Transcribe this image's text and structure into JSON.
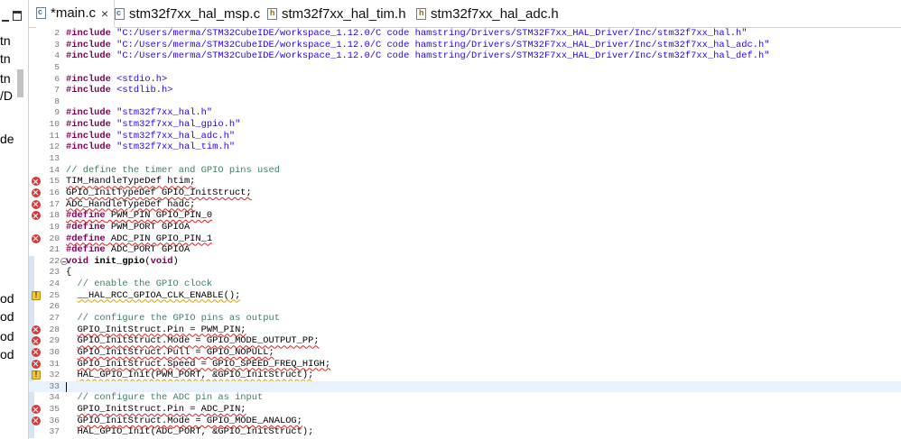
{
  "left_panel": {
    "fragments": [
      "tn",
      "tn",
      "tn",
      "/D",
      "de",
      "od",
      "od",
      "od",
      "od"
    ]
  },
  "tabs": [
    {
      "label": "*main.c",
      "kind": "c",
      "active": true,
      "closable": true
    },
    {
      "label": "stm32f7xx_hal_msp.c",
      "kind": "c",
      "active": false,
      "closable": false
    },
    {
      "label": "stm32f7xx_hal_tim.h",
      "kind": "h",
      "active": false,
      "closable": false
    },
    {
      "label": "stm32f7xx_hal_adc.h",
      "kind": "h",
      "active": false,
      "closable": false
    }
  ],
  "editor": {
    "lines": [
      {
        "n": "2",
        "tokens": [
          [
            "kw",
            "#include"
          ],
          [
            "",
            " "
          ],
          [
            "str",
            "\"C:/Users/merma/STM32CubeIDE/workspace_1.12.0/C code hamstring/Drivers/STM32F7xx_HAL_Driver/Inc/stm32f7xx_hal.h\""
          ]
        ]
      },
      {
        "n": "3",
        "tokens": [
          [
            "kw",
            "#include"
          ],
          [
            "",
            " "
          ],
          [
            "str",
            "\"C:/Users/merma/STM32CubeIDE/workspace_1.12.0/C code hamstring/Drivers/STM32F7xx_HAL_Driver/Inc/stm32f7xx_hal_adc.h\""
          ]
        ]
      },
      {
        "n": "4",
        "tokens": [
          [
            "kw",
            "#include"
          ],
          [
            "",
            " "
          ],
          [
            "str",
            "\"C:/Users/merma/STM32CubeIDE/workspace_1.12.0/C code hamstring/Drivers/STM32F7xx_HAL_Driver/Inc/stm32f7xx_hal_def.h\""
          ]
        ]
      },
      {
        "n": "5",
        "tokens": []
      },
      {
        "n": "6",
        "tokens": [
          [
            "kw",
            "#include"
          ],
          [
            "",
            " "
          ],
          [
            "str",
            "<stdio.h>"
          ]
        ]
      },
      {
        "n": "7",
        "tokens": [
          [
            "kw",
            "#include"
          ],
          [
            "",
            " "
          ],
          [
            "str",
            "<stdlib.h>"
          ]
        ]
      },
      {
        "n": "8",
        "tokens": []
      },
      {
        "n": "9",
        "tokens": [
          [
            "kw",
            "#include"
          ],
          [
            "",
            " "
          ],
          [
            "str",
            "\"stm32f7xx_hal.h\""
          ]
        ]
      },
      {
        "n": "10",
        "tokens": [
          [
            "kw",
            "#include"
          ],
          [
            "",
            " "
          ],
          [
            "str",
            "\"stm32f7xx_hal_gpio.h\""
          ]
        ]
      },
      {
        "n": "11",
        "tokens": [
          [
            "kw",
            "#include"
          ],
          [
            "",
            " "
          ],
          [
            "str",
            "\"stm32f7xx_hal_adc.h\""
          ]
        ]
      },
      {
        "n": "12",
        "tokens": [
          [
            "kw",
            "#include"
          ],
          [
            "",
            " "
          ],
          [
            "str",
            "\"stm32f7xx_hal_tim.h\""
          ]
        ]
      },
      {
        "n": "13",
        "tokens": []
      },
      {
        "n": "14",
        "tokens": [
          [
            "cmt",
            "// define the timer and GPIO pins used"
          ]
        ]
      },
      {
        "n": "15",
        "marker": "error",
        "tokens": [
          [
            "err",
            "TIM_HandleTypeDef htim;"
          ]
        ]
      },
      {
        "n": "16",
        "marker": "error",
        "tokens": [
          [
            "err",
            "GPIO_InitTypeDef GPIO_InitStruct;"
          ]
        ]
      },
      {
        "n": "17",
        "marker": "error",
        "tokens": [
          [
            "err",
            "ADC_HandleTypeDef hadc;"
          ]
        ]
      },
      {
        "n": "18",
        "marker": "error",
        "tokens": [
          [
            "kw err",
            "#define"
          ],
          [
            "err",
            " PWM_PIN GPIO_PIN_0"
          ]
        ]
      },
      {
        "n": "19",
        "tokens": [
          [
            "kw",
            "#define"
          ],
          [
            "",
            " PWM_PORT GPIOA"
          ]
        ]
      },
      {
        "n": "20",
        "marker": "error",
        "tokens": [
          [
            "kw err",
            "#define"
          ],
          [
            "err",
            " ADC_PIN GPIO_PIN_1"
          ]
        ]
      },
      {
        "n": "21",
        "tokens": [
          [
            "kw",
            "#define"
          ],
          [
            "",
            " ADC_PORT GPIOA"
          ]
        ]
      },
      {
        "n": "22",
        "fold": true,
        "tokens": [
          [
            "kw",
            "void"
          ],
          [
            "",
            " "
          ],
          [
            "b",
            "init_gpio"
          ],
          [
            "",
            "("
          ],
          [
            "kw",
            "void"
          ],
          [
            "",
            ")"
          ]
        ]
      },
      {
        "n": "23",
        "tokens": [
          [
            "",
            "{"
          ]
        ]
      },
      {
        "n": "24",
        "tokens": [
          [
            "",
            "  "
          ],
          [
            "cmt",
            "// enable the GPIO clock"
          ]
        ]
      },
      {
        "n": "25",
        "marker": "warning",
        "tokens": [
          [
            "",
            "  "
          ],
          [
            "warn",
            "__HAL_RCC_GPIOA_CLK_ENABLE();"
          ]
        ]
      },
      {
        "n": "26",
        "tokens": []
      },
      {
        "n": "27",
        "tokens": [
          [
            "",
            "  "
          ],
          [
            "cmt",
            "// configure the GPIO pins as output"
          ]
        ]
      },
      {
        "n": "28",
        "marker": "error",
        "tokens": [
          [
            "",
            "  "
          ],
          [
            "err",
            "GPIO_InitStruct.Pin = PWM_PIN;"
          ]
        ]
      },
      {
        "n": "29",
        "marker": "error",
        "tokens": [
          [
            "",
            "  "
          ],
          [
            "err",
            "GPIO_InitStruct.Mode = GPIO_MODE_OUTPUT_PP;"
          ]
        ]
      },
      {
        "n": "30",
        "marker": "error",
        "tokens": [
          [
            "",
            "  "
          ],
          [
            "err",
            "GPIO_InitStruct.Pull = GPIO_NOPULL;"
          ]
        ]
      },
      {
        "n": "31",
        "marker": "error",
        "tokens": [
          [
            "",
            "  "
          ],
          [
            "err",
            "GPIO_InitStruct.Speed = GPIO_SPEED_FREQ_HIGH;"
          ]
        ]
      },
      {
        "n": "32",
        "marker": "warning",
        "tokens": [
          [
            "",
            "  "
          ],
          [
            "warn",
            "HAL_GPIO_Init(PWM_PORT, &GPIO_InitStruct);"
          ]
        ]
      },
      {
        "n": "33",
        "current": true,
        "tokens": []
      },
      {
        "n": "34",
        "tokens": [
          [
            "",
            "  "
          ],
          [
            "cmt",
            "// configure the ADC pin as input"
          ]
        ]
      },
      {
        "n": "35",
        "marker": "error",
        "tokens": [
          [
            "",
            "  "
          ],
          [
            "err",
            "GPIO_InitStruct.Pin = ADC_PIN;"
          ]
        ]
      },
      {
        "n": "36",
        "marker": "error",
        "tokens": [
          [
            "",
            "  "
          ],
          [
            "err",
            "GPIO_InitStruct.Mode = GPIO_MODE_ANALOG;"
          ]
        ]
      },
      {
        "n": "37",
        "tokens": [
          [
            "",
            "  HAL_GPIO_Init(ADC_PORT, &GPIO_InitStruct);"
          ]
        ]
      }
    ]
  },
  "colors": {
    "keyword": "#7f0055",
    "string": "#2a00ff",
    "comment": "#3f7f5f",
    "error": "#d53a3a",
    "warning": "#f0c63a",
    "current_line": "#e8f2fe"
  }
}
